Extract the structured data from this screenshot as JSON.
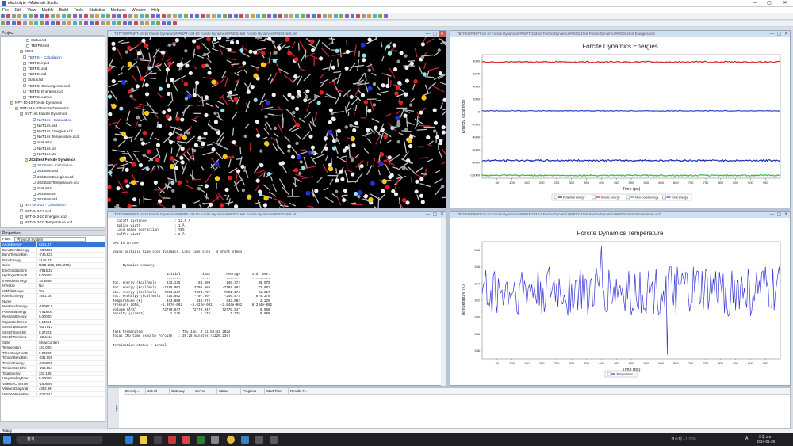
{
  "app": {
    "title": "electrolyte - Materials Studio",
    "close_glyph": "✕",
    "max_glyph": "▢",
    "min_glyph": "—"
  },
  "menu": [
    "File",
    "Edit",
    "View",
    "Modify",
    "Build",
    "Tools",
    "Statistics",
    "Modules",
    "Window",
    "Help"
  ],
  "project": {
    "header": "Project",
    "items": [
      {
        "label": "Status.txt",
        "indent": 32,
        "color": "#111"
      },
      {
        "label": "TBTFSI.xtd",
        "indent": 32,
        "color": "#111"
      },
      {
        "label": "2024",
        "indent": 24,
        "color": "#111",
        "folder": true
      },
      {
        "label": "TBTFSI - Calculation",
        "indent": 28,
        "color": "#1b3fa6"
      },
      {
        "label": "TBTFSI.input",
        "indent": 28,
        "color": "#111"
      },
      {
        "label": "TBTFSI.xsd",
        "indent": 28,
        "color": "#111"
      },
      {
        "label": "TBTFSI.xtd",
        "indent": 28,
        "color": "#111"
      },
      {
        "label": "Status.txt",
        "indent": 28,
        "color": "#111"
      },
      {
        "label": "TBTFSI Convergence.xcd",
        "indent": 28,
        "color": "#111"
      },
      {
        "label": "TBTFSI Energies.xcd",
        "indent": 28,
        "color": "#111"
      },
      {
        "label": "TBTFSI.outmol",
        "indent": 28,
        "color": "#111"
      },
      {
        "label": "NPT-10-10 Forcite Dynamics",
        "indent": 12,
        "color": "#111",
        "folder": true
      },
      {
        "label": "NPT-343-10 Forcite Dynamics",
        "indent": 18,
        "color": "#111",
        "folder": true
      },
      {
        "label": "NVT1ns Forcite Dynamics",
        "indent": 24,
        "color": "#111",
        "folder": true
      },
      {
        "label": "NVT1ns - Calculation",
        "indent": 40,
        "color": "#1b3fa6"
      },
      {
        "label": "NVT1ns.xsd",
        "indent": 40,
        "color": "#111"
      },
      {
        "label": "NVT1ns Energies.xcd",
        "indent": 40,
        "color": "#111"
      },
      {
        "label": "NVT1ns Temperature.xcd",
        "indent": 40,
        "color": "#111"
      },
      {
        "label": "Status.txt",
        "indent": 40,
        "color": "#111"
      },
      {
        "label": "NVT1ns.txt",
        "indent": 40,
        "color": "#111"
      },
      {
        "label": "NVT1ns.xtd",
        "indent": 40,
        "color": "#111"
      },
      {
        "label": "2024test Forcite Dynamics",
        "indent": 30,
        "color": "#111",
        "folder": true,
        "bold": true
      },
      {
        "label": "2024test - Calculation",
        "indent": 40,
        "color": "#1b3fa6"
      },
      {
        "label": "2024test.xsd",
        "indent": 40,
        "color": "#111"
      },
      {
        "label": "2024test Energies.xcd",
        "indent": 40,
        "color": "#111"
      },
      {
        "label": "2024test Temperature.xcd",
        "indent": 40,
        "color": "#111"
      },
      {
        "label": "Status.txt",
        "indent": 40,
        "color": "#111"
      },
      {
        "label": "2024test.txt",
        "indent": 40,
        "color": "#111"
      },
      {
        "label": "2024test.xtd",
        "indent": 40,
        "color": "#111"
      },
      {
        "label": "NPT-343-12 - Calculation",
        "indent": 24,
        "color": "#1b3fa6"
      },
      {
        "label": "NPT-343-12.xsd",
        "indent": 24,
        "color": "#111"
      },
      {
        "label": "NPT-343-10 Energies.xcd",
        "indent": 24,
        "color": "#111"
      },
      {
        "label": "NPT-343-10 Temperature.xcd",
        "indent": 24,
        "color": "#111"
      }
    ]
  },
  "properties": {
    "header": "Properties",
    "filter_label": "Filter:",
    "filter_value": "Physical System",
    "rows": [
      [
        "AngleEnergy",
        "6281.47"
      ],
      [
        "BendBendEnergy",
        "-49.5526"
      ],
      [
        "BendTorsionBen",
        "-746.923"
      ],
      [
        "BondEnergy",
        "3145.43"
      ],
      [
        "Color",
        "RGB (255, 255, 255)"
      ],
      [
        "ElectrostaticEne",
        "-7815.32"
      ],
      [
        "HydrogenBondE",
        "0.00000"
      ],
      [
        "InversionEnergy",
        "15.3869"
      ],
      [
        "IsVisible",
        "No"
      ],
      [
        "IsWhileRange",
        "Yes"
      ],
      [
        "KineticEnergy",
        "7851.14"
      ],
      [
        "Name",
        ""
      ],
      [
        "NonBondEnergy",
        "-18082.1"
      ],
      [
        "PotentialEnergy",
        "-7518.00"
      ],
      [
        "RestraintEnergy",
        "0.00000"
      ],
      [
        "SeparatedStretc",
        "6.14664"
      ],
      [
        "StretchBendStre",
        "-93.7943"
      ],
      [
        "StretchStretchE",
        "6.37223"
      ],
      [
        "StretchTorsionS",
        "-92.6414"
      ],
      [
        "Style",
        "ShowContent"
      ],
      [
        "Temperature",
        "343.000"
      ],
      [
        "ThreeBodyNonB",
        "0.00000"
      ],
      [
        "TorsionBendBen",
        "-631.908"
      ],
      [
        "TorsionEnergy",
        "-5059.58"
      ],
      [
        "TorsionStretchE",
        "-266.554"
      ],
      [
        "TotalEnergy",
        "333.135"
      ],
      [
        "UreyBradleyEner",
        "0.00000"
      ],
      [
        "ValenceCrossTer",
        "-1806.86"
      ],
      [
        "ValenceDiagonal",
        "4382.99"
      ],
      [
        "VanDerWaalsEne",
        "-2262.43"
      ]
    ]
  },
  "windows": {
    "structure_title": "TBTFSI###NPT-10-10 Forcite Dynamics###NPT-343-10 Forcite Dynamics###2024test Forcite Dynamics###2024test.xtd",
    "energy_title": "TBTFSI###NPT-10-10 Forcite Dynamics###NPT-343-10 Forcite Dynamics###2024test Forcite Dynamics###2024test Energies.xcd",
    "text_title": "TBTFSI###NPT-10-10 Forcite Dynamics###NPT-343-10 Forcite Dynamics###2024test Forcite Dynamics###2024test.txt",
    "temp_title": "TBTFSI###NPT-10-10 Forcite Dynamics###NPT-343-10 Forcite Dynamics###2024test Forcite Dynamics###2024test Temperature.xcd"
  },
  "text_output": "  Cutoff distance              : 12.5 Å\n  Spline width                 : 1 Å\n  Long range correction        : YES\n  Buffer width                 : 2 Å\n\nGPU is in use\n\nUsing multiple time step dynamics. Long time step : 4 short steps\n\n\n---- Dynamics summary ----\n\n                           Initial          Final        Average      Std. Dev.\n                           -------          -----        -------      ---------\nTot. energy (kcal/mol)     333.135         94.609        146.372         49.579\nPot. energy (kcal/mol)   -7518.002      -7709.988      -7704.802         72.001\nKin. energy (kcal/mol)    7851.137       7804.797       7851.174         51.017\nTot. enthalpy (kcal/mol)   215.662       -707.007       -240.573        879.276\nTemperature (K)            343.000        340.976        343.002          2.229\nPressure (GPa)          -1.097e-002    -8.022e-002    -3.644e-002     8.234e-002\nVolume (Å^3)             72770.947      72770.947      72770.947          0.000\nDensity (g/cm^3)             1.175          1.175          1.175          0.000\n\n\n\nTask terminated                  : Thu Jan  4 11:53:43 2024\nTotal CPU time used by Forcite   : 20:26 minutes (1226.23s)\n\nTermination status : Normal",
  "jobs": {
    "side_label": "Jobs",
    "columns": [
      "Descrip...",
      "Job Id",
      "Gateway",
      "Server",
      "Status",
      "Progress",
      "Start Time",
      "Results F..."
    ]
  },
  "status_bar": "Ready",
  "taskbar": {
    "search": "찾기",
    "stock": "코스피",
    "stock_change": "+1.26%",
    "lang": "A",
    "time": "오후 2:57",
    "date": "2024-01-29"
  },
  "chart_data": [
    {
      "type": "line",
      "title": "Forcite Dynamics Energies",
      "xlabel": "Time (ps)",
      "ylabel": "Energy (kcal/mol)",
      "x_ticks": [
        50,
        100,
        150,
        200,
        250,
        300,
        350,
        400,
        450,
        500,
        550,
        600,
        650,
        700,
        750,
        800,
        850,
        900,
        950
      ],
      "y_ticks": [
        -10000,
        -8000,
        -6000,
        -4000,
        -2000,
        0,
        2000,
        4000,
        6000,
        8000
      ],
      "xlim": [
        0,
        1000
      ],
      "ylim": [
        -10500,
        9000
      ],
      "legend_position": "bottom",
      "series": [
        {
          "name": "Potential energy",
          "color": "#1c2bb0",
          "mean": -7700,
          "noise": 120
        },
        {
          "name": "Kinetic energy",
          "color": "#d8282a",
          "mean": 7850,
          "noise": 110
        },
        {
          "name": "Non-bond energy",
          "color": "#2fbd3c",
          "mean": -10050,
          "noise": 90
        },
        {
          "name": "Total energy",
          "color": "#3148c8",
          "mean": 140,
          "noise": 60
        }
      ]
    },
    {
      "type": "line",
      "title": "Forcite Dynamics Temperature",
      "xlabel": "Time (ps)",
      "ylabel": "Temperature (K)",
      "x_ticks": [
        50,
        100,
        150,
        200,
        250,
        300,
        350,
        400,
        450,
        500,
        550,
        600,
        650,
        700,
        750,
        800,
        850,
        900,
        950
      ],
      "y_ticks": [
        336,
        338,
        340,
        342,
        344,
        346,
        348
      ],
      "xlim": [
        0,
        1000
      ],
      "ylim": [
        335,
        349
      ],
      "legend_position": "bottom",
      "series": [
        {
          "name": "Temperature",
          "color": "#3a38d6",
          "mean": 343,
          "std": 2.2,
          "min": 335.5,
          "max": 348.5
        }
      ]
    }
  ]
}
